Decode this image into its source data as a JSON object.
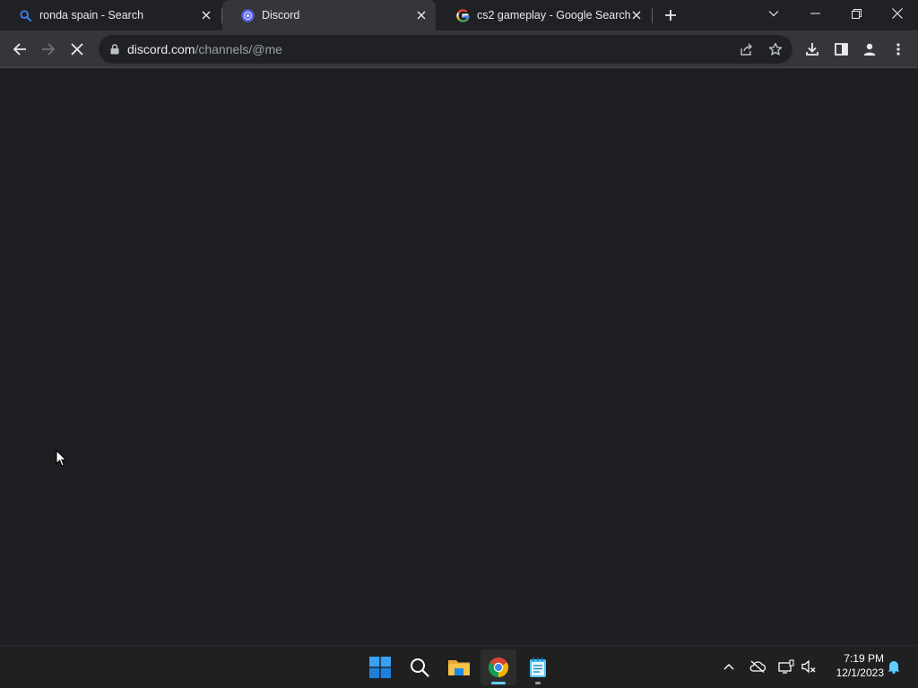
{
  "browser": {
    "tabs": [
      {
        "title": "ronda spain - Search",
        "favicon": "search-favicon-icon",
        "active": false
      },
      {
        "title": "Discord",
        "favicon": "discord-favicon-icon",
        "active": true
      },
      {
        "title": "cs2 gameplay - Google Search",
        "favicon": "google-favicon-icon",
        "active": false
      }
    ],
    "address_bar": {
      "domain": "discord.com",
      "path": "/channels/@me"
    }
  },
  "taskbar": {
    "pinned": [
      "windows-start-icon",
      "search-icon",
      "file-explorer-icon",
      "chrome-icon",
      "notepad-icon"
    ],
    "clock": {
      "time": "7:19 PM",
      "date": "12/1/2023"
    }
  },
  "colors": {
    "tab_strip": "#202124",
    "toolbar": "#35363a",
    "content": "#1e1f22",
    "taskbar": "#202020"
  }
}
